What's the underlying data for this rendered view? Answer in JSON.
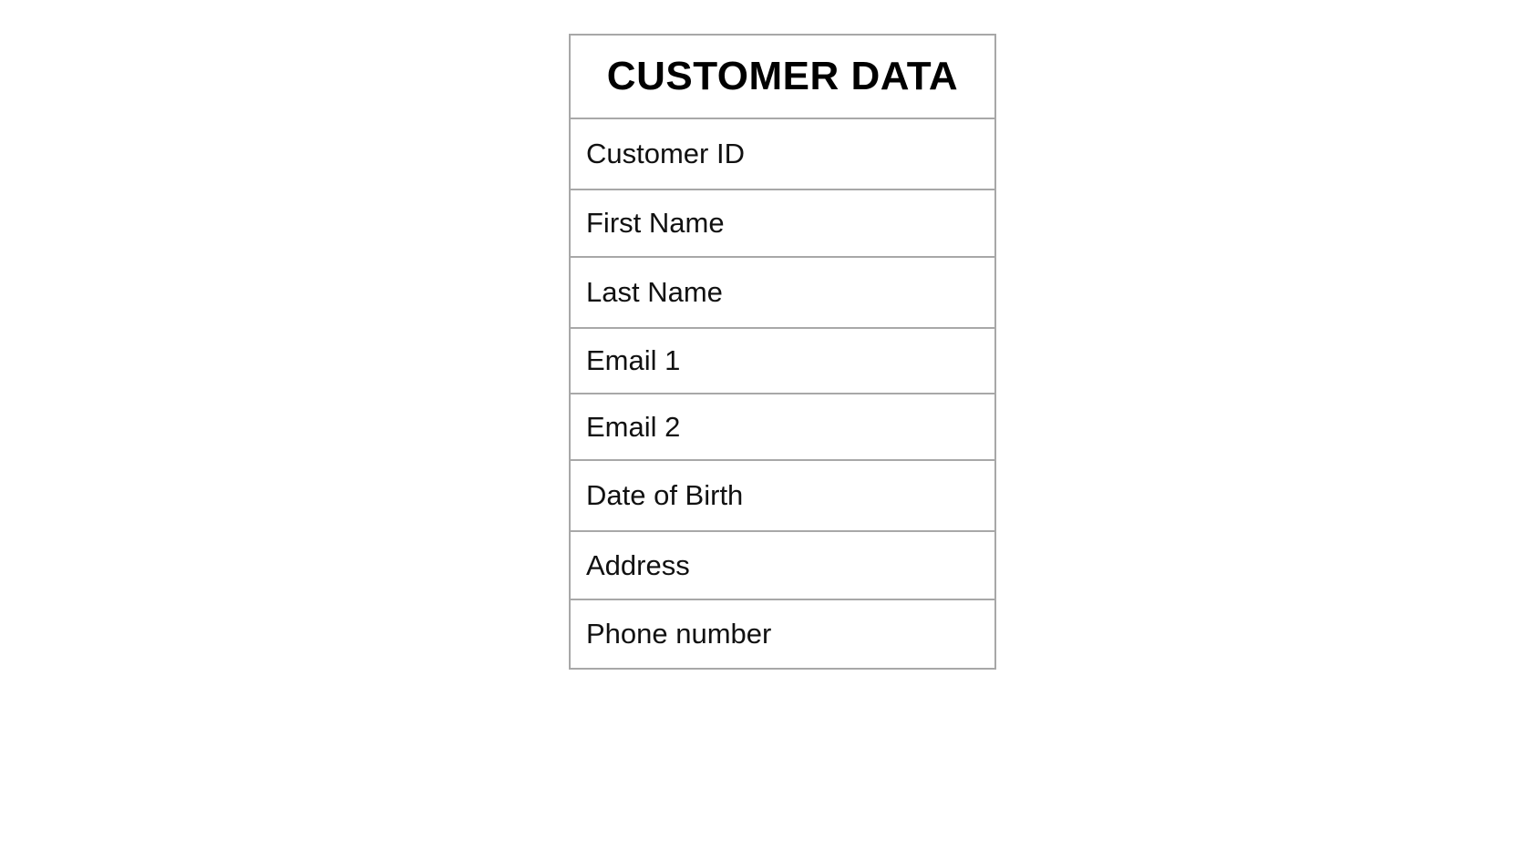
{
  "table": {
    "title": "CUSTOMER DATA",
    "fields": [
      "Customer ID",
      "First Name",
      "Last Name",
      "Email 1",
      "Email 2",
      "Date of Birth",
      "Address",
      "Phone number"
    ],
    "border_color": "#a8a8a8"
  }
}
